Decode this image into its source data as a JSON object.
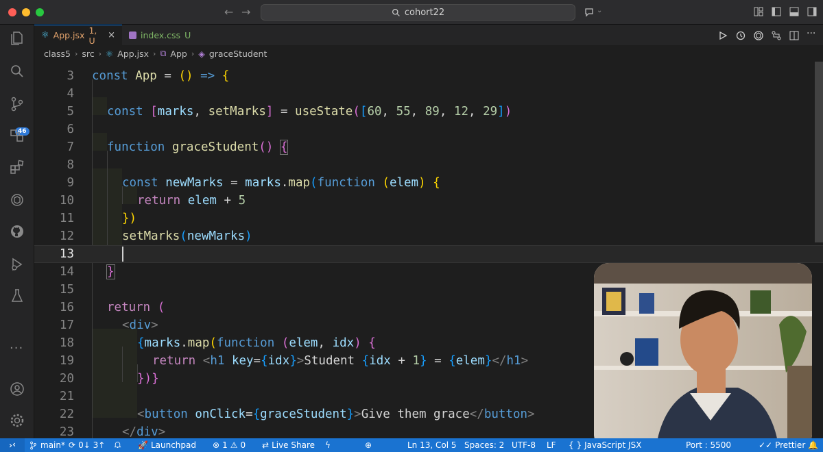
{
  "titlebar": {
    "search_text": "cohort22"
  },
  "activity_bar": {
    "source_control_badge": "46"
  },
  "tabs": [
    {
      "filename": "App.jsx",
      "status": "1, U"
    },
    {
      "filename": "index.css",
      "status": "U"
    }
  ],
  "breadcrumb": [
    "class5",
    "src",
    "App.jsx",
    "App",
    "graceStudent"
  ],
  "editor": {
    "current_line": 13,
    "lines": [
      {
        "n": "3"
      },
      {
        "n": "4"
      },
      {
        "n": "5"
      },
      {
        "n": "6"
      },
      {
        "n": "7"
      },
      {
        "n": "8"
      },
      {
        "n": "9"
      },
      {
        "n": "10"
      },
      {
        "n": "11"
      },
      {
        "n": "12"
      },
      {
        "n": "13"
      },
      {
        "n": "14"
      },
      {
        "n": "15"
      },
      {
        "n": "16"
      },
      {
        "n": "17"
      },
      {
        "n": "18"
      },
      {
        "n": "19"
      },
      {
        "n": "20"
      },
      {
        "n": "21"
      },
      {
        "n": "22"
      },
      {
        "n": "23"
      }
    ],
    "code": {
      "l3": [
        "const",
        "App",
        "=",
        "()",
        "=>",
        "{"
      ],
      "l5": [
        "const",
        "[",
        "marks",
        ",",
        "setMarks",
        "]",
        "=",
        "useState",
        "(",
        "[",
        "60",
        "55",
        "89",
        "12",
        "29",
        "]",
        ")"
      ],
      "l7": [
        "function",
        "graceStudent",
        "()",
        "{"
      ],
      "l9": [
        "const",
        "newMarks",
        "=",
        "marks",
        ".",
        "map",
        "(",
        "function",
        "(",
        "elem",
        ")",
        "{"
      ],
      "l10": [
        "return",
        "elem",
        "+",
        "5"
      ],
      "l11": [
        "})"
      ],
      "l12": [
        "setMarks",
        "(",
        "newMarks",
        ")"
      ],
      "l14": [
        "}"
      ],
      "l16": [
        "return",
        "("
      ],
      "l17": [
        "<",
        "div",
        ">"
      ],
      "l18": [
        "{",
        "marks",
        ".",
        "map",
        "(",
        "function",
        "(",
        "elem",
        ",",
        "idx",
        ")",
        "{"
      ],
      "l19": [
        "return",
        "<",
        "h1",
        "key",
        "=",
        "{",
        "idx",
        "}",
        ">",
        "Student",
        "{",
        "idx",
        "+",
        "1",
        "}",
        "=",
        "{",
        "elem",
        "}",
        "</",
        "h1",
        ">"
      ],
      "l20": [
        "})}"
      ],
      "l22": [
        "<",
        "button",
        "onClick",
        "=",
        "{",
        "graceStudent",
        "}",
        ">",
        "Give them grace",
        "</",
        "button",
        ">"
      ],
      "l23": [
        "</",
        "div",
        ">"
      ]
    }
  },
  "statusbar": {
    "branch": "main*",
    "sync": "0↓ 3↑",
    "launchpad": "Launchpad",
    "errors": "1",
    "warnings": "0",
    "live_share": "Live Share",
    "position": "Ln 13, Col 5",
    "spaces": "Spaces: 2",
    "encoding": "UTF-8",
    "eol": "LF",
    "language": "JavaScript JSX",
    "port": "Port : 5500",
    "prettier": "Prettier"
  },
  "colors": {
    "statusbar_bg": "#1a73d1",
    "active_tab_text": "#e2a36c",
    "untracked_text": "#80b867",
    "keyword": "#569cd6",
    "function": "#dcdcaa",
    "variable": "#9cdcfe",
    "number": "#b5cea8"
  }
}
